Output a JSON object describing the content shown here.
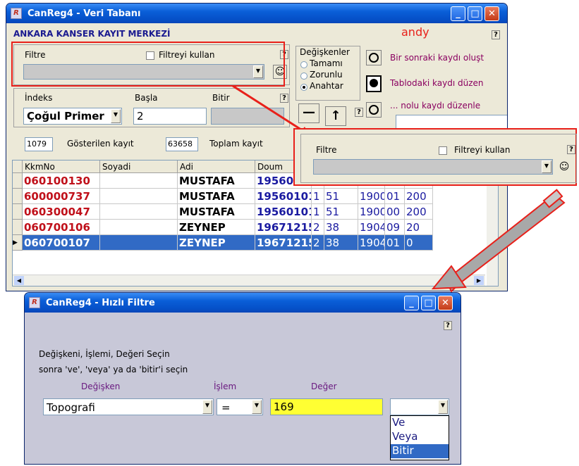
{
  "main_window": {
    "title": "CanReg4 - Veri Tabanı",
    "icon_label": "R",
    "org_title": "ANKARA KANSER KAYIT MERKEZİ",
    "user": "andy",
    "help_q": "?",
    "filter": {
      "label": "Filtre",
      "use_label": "Filtreyi kullan",
      "value": ""
    },
    "variables": {
      "title": "Değişkenler",
      "opt_all": "Tamamı",
      "opt_required": "Zorunlu",
      "opt_key": "Anahtar",
      "selected": "Anahtar"
    },
    "actions": {
      "next_record": "Bir sonraki kaydı oluşt",
      "edit_table_record": "Tablodaki kaydı düzen",
      "edit_nolu": "... nolu kaydı düzenle"
    },
    "index": {
      "label": "İndeks",
      "value": "Çoğul Primer",
      "start_label": "Başla",
      "start_value": "2",
      "end_label": "Bitir",
      "end_value": ""
    },
    "counts": {
      "shown_value": "1079",
      "shown_label": "Gösterilen kayıt",
      "total_value": "63658",
      "total_label": "Toplam kayıt"
    },
    "table": {
      "headers": [
        "KkmNo",
        "Soyadi",
        "Adi",
        "Doum"
      ],
      "rows": [
        {
          "kkmno": "060100130",
          "soyadi": "",
          "adi": "MUSTAFA",
          "doum": "19560101",
          "c5": "1",
          "c6": "50",
          "c7": "1900",
          "c8": "6b",
          "c9": "200"
        },
        {
          "kkmno": "600000737",
          "soyadi": "",
          "adi": "MUSTAFA",
          "doum": "19560101",
          "c5": "1",
          "c6": "51",
          "c7": "1900",
          "c8": "01",
          "c9": "200"
        },
        {
          "kkmno": "060300047",
          "soyadi": "",
          "adi": "MUSTAFA",
          "doum": "19560101",
          "c5": "1",
          "c6": "51",
          "c7": "1900",
          "c8": "00",
          "c9": "200"
        },
        {
          "kkmno": "060700106",
          "soyadi": "",
          "adi": "ZEYNEP",
          "doum": "19671215",
          "c5": "2",
          "c6": "38",
          "c7": "1904",
          "c8": "09",
          "c9": "20"
        },
        {
          "kkmno": "060700107",
          "soyadi": "",
          "adi": "ZEYNEP",
          "doum": "19671215",
          "c5": "2",
          "c6": "38",
          "c7": "1904",
          "c8": "01",
          "c9": "0"
        }
      ],
      "selected_row": 4
    }
  },
  "zoom_callout": {
    "filter_label": "Filtre",
    "use_label": "Filtreyi kullan",
    "help_q": "?"
  },
  "quick_filter": {
    "title": "CanReg4 - Hızlı Filtre",
    "icon_label": "R",
    "help_q": "?",
    "instruction_1": "Değişkeni, İşlemi, Değeri Seçin",
    "instruction_2": "sonra 've', 'veya' ya da 'bitir'i seçin",
    "col_variable": "Değişken",
    "col_operation": "İşlem",
    "col_value": "Değer",
    "variable_value": "Topografi",
    "operation_value": "=",
    "value_input": "169",
    "logic_value": "",
    "logic_options": [
      "Ve",
      "Veya",
      "Bitir"
    ],
    "highlighted_option": "Bitir"
  },
  "colors": {
    "accent_red": "#e8201a",
    "title_blue": "#0a5fd8",
    "selection": "#316ac5",
    "value_yellow": "#ffff33",
    "kkm_red": "#c0101a",
    "num_blue": "#1a1aa0"
  }
}
